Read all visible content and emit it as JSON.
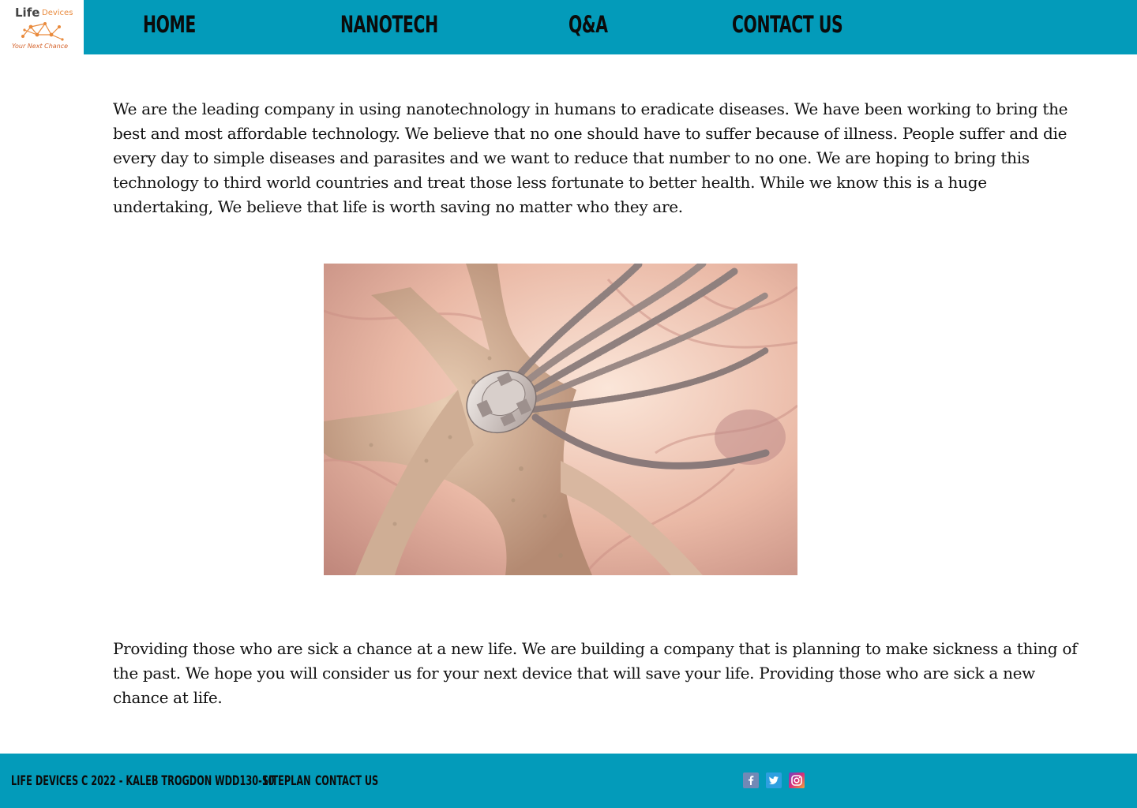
{
  "logo": {
    "word1": "Life",
    "word2": "Devices",
    "tagline": "Your Next Chance"
  },
  "nav": {
    "items": [
      {
        "label": "HOME"
      },
      {
        "label": "NANOTECH"
      },
      {
        "label": "Q&A"
      },
      {
        "label": "CONTACT US"
      }
    ]
  },
  "main": {
    "intro": "We are the leading company in using nanotechnology in humans to eradicate diseases. We have been working to bring the best and most affordable technology. We believe that no one should have to suffer because of illness. People suffer and die every day to simple diseases and parasites and we want to reduce that number to no one. We are hoping to bring this technology to third world countries and treat those less fortunate to better health. While we know this is a huge undertaking, We believe that life is worth saving no matter who they are.",
    "closing": "Providing those who are sick a chance at a new life. We are building a company that is planning to make sickness a thing of the past. We hope you will consider us for your next device that will save your life. Providing those who are sick a new chance at life."
  },
  "footer": {
    "copyright": "Life Devices c 2022 - Kaleb Trogdon WDD130-10",
    "siteplan": "Siteplan",
    "contact": "Contact Us"
  },
  "icons": {
    "social": [
      "facebook-icon",
      "twitter-icon",
      "instagram-icon"
    ]
  },
  "colors": {
    "brand": "#039bba",
    "logo_accent": "#e98a3c"
  }
}
